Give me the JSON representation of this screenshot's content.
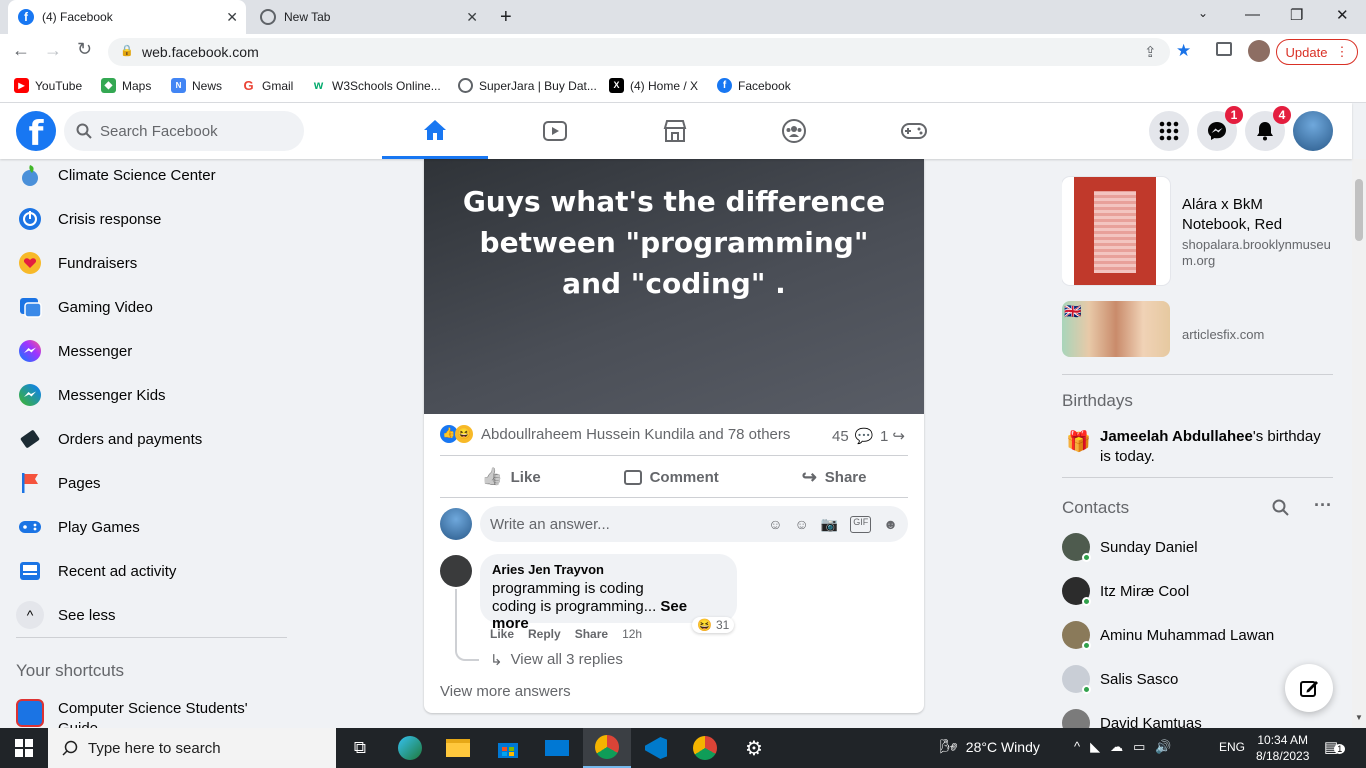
{
  "browser": {
    "tabs": [
      {
        "title": "(4) Facebook"
      },
      {
        "title": "New Tab"
      }
    ],
    "url": "web.facebook.com",
    "update_label": "Update",
    "bookmarks": [
      {
        "label": "YouTube"
      },
      {
        "label": "Maps"
      },
      {
        "label": "News"
      },
      {
        "label": "Gmail"
      },
      {
        "label": "W3Schools Online..."
      },
      {
        "label": "SuperJara | Buy Dat..."
      },
      {
        "label": "(4) Home / X"
      },
      {
        "label": "Facebook"
      }
    ]
  },
  "fb": {
    "search_placeholder": "Search Facebook",
    "messenger_badge": "1",
    "notifications_badge": "4"
  },
  "left_nav": {
    "items": [
      {
        "label": "Climate Science Center"
      },
      {
        "label": "Crisis response"
      },
      {
        "label": "Fundraisers"
      },
      {
        "label": "Gaming Video"
      },
      {
        "label": "Messenger"
      },
      {
        "label": "Messenger Kids"
      },
      {
        "label": "Orders and payments"
      },
      {
        "label": "Pages"
      },
      {
        "label": "Play Games"
      },
      {
        "label": "Recent ad activity"
      },
      {
        "label": "See less"
      }
    ],
    "shortcuts_title": "Your shortcuts",
    "shortcut": "Computer Science Students' Guide"
  },
  "post": {
    "text": "Guys what's the difference between \"programming\" and \"coding\" .",
    "reactions_text": "Abdoullraheem Hussein Kundila and 78 others",
    "comments_count": "45",
    "shares_count": "1",
    "like_label": "Like",
    "comment_label": "Comment",
    "share_label": "Share",
    "answer_placeholder": "Write an answer...",
    "comment": {
      "author": "Aries Jen Trayvon",
      "line1": "programming is coding",
      "line2": "coding is programming...",
      "see_more": "See more",
      "like": "Like",
      "reply": "Reply",
      "share": "Share",
      "time": "12h",
      "reaction_count": "31"
    },
    "view_replies": "View all 3 replies",
    "view_more": "View more answers"
  },
  "right_col": {
    "ad1": {
      "title": "Alára x BkM Notebook, Red",
      "domain": "shopalara.brooklynmuseum.org"
    },
    "ad2": {
      "domain": "articlesfix.com"
    },
    "birthdays_title": "Birthdays",
    "birthday_name": "Jameelah Abdullahee",
    "birthday_text": "'s birthday is today.",
    "contacts_title": "Contacts",
    "contacts": [
      {
        "name": "Sunday Daniel"
      },
      {
        "name": "Itz Miræ Cool"
      },
      {
        "name": "Aminu Muhammad Lawan"
      },
      {
        "name": "Salis Sasco"
      },
      {
        "name": "David Kamtuas"
      }
    ]
  },
  "taskbar": {
    "search_placeholder": "Type here to search",
    "weather": "28°C  Windy",
    "language": "ENG",
    "time": "10:34 AM",
    "date": "8/18/2023",
    "notification_count": "1"
  }
}
